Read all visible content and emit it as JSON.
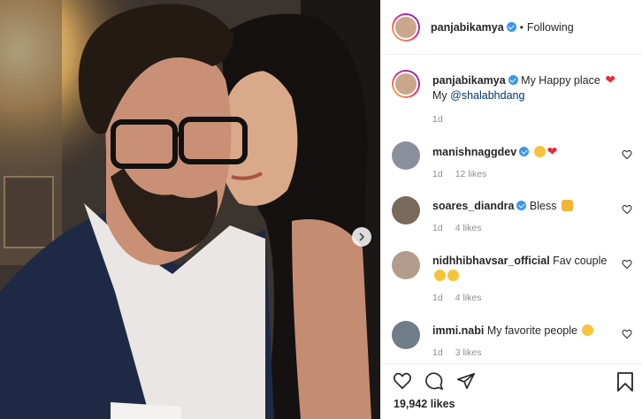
{
  "post": {
    "author": "panjabikamya",
    "following_label": "Following",
    "dot": "•"
  },
  "caption": {
    "username": "panjabikamya",
    "text": "My Happy place",
    "line2_prefix": "My",
    "mention": "@shalabhdang",
    "age": "1d"
  },
  "comments": [
    {
      "username": "manishnaggdev",
      "verified": true,
      "text": "",
      "age": "1d",
      "likes": "12 likes"
    },
    {
      "username": "soares_diandra",
      "verified": true,
      "text": "Bless",
      "age": "1d",
      "likes": "4 likes"
    },
    {
      "username": "nidhhibhavsar_official",
      "verified": false,
      "text": "Fav couple",
      "age": "1d",
      "likes": "4 likes"
    },
    {
      "username": "immi.nabi",
      "verified": false,
      "text": "My favorite people",
      "age": "1d",
      "likes": "3 likes"
    }
  ],
  "footer": {
    "likes_count": "19,942 likes"
  },
  "icons": {
    "like": "heart-icon",
    "comment": "comment-icon",
    "share": "share-icon",
    "save": "bookmark-icon",
    "next": "chevron-right-icon"
  },
  "colors": {
    "verified": "#3897f0",
    "mention": "#00376b",
    "muted": "#8e8e8e",
    "heart": "#ed2939"
  }
}
